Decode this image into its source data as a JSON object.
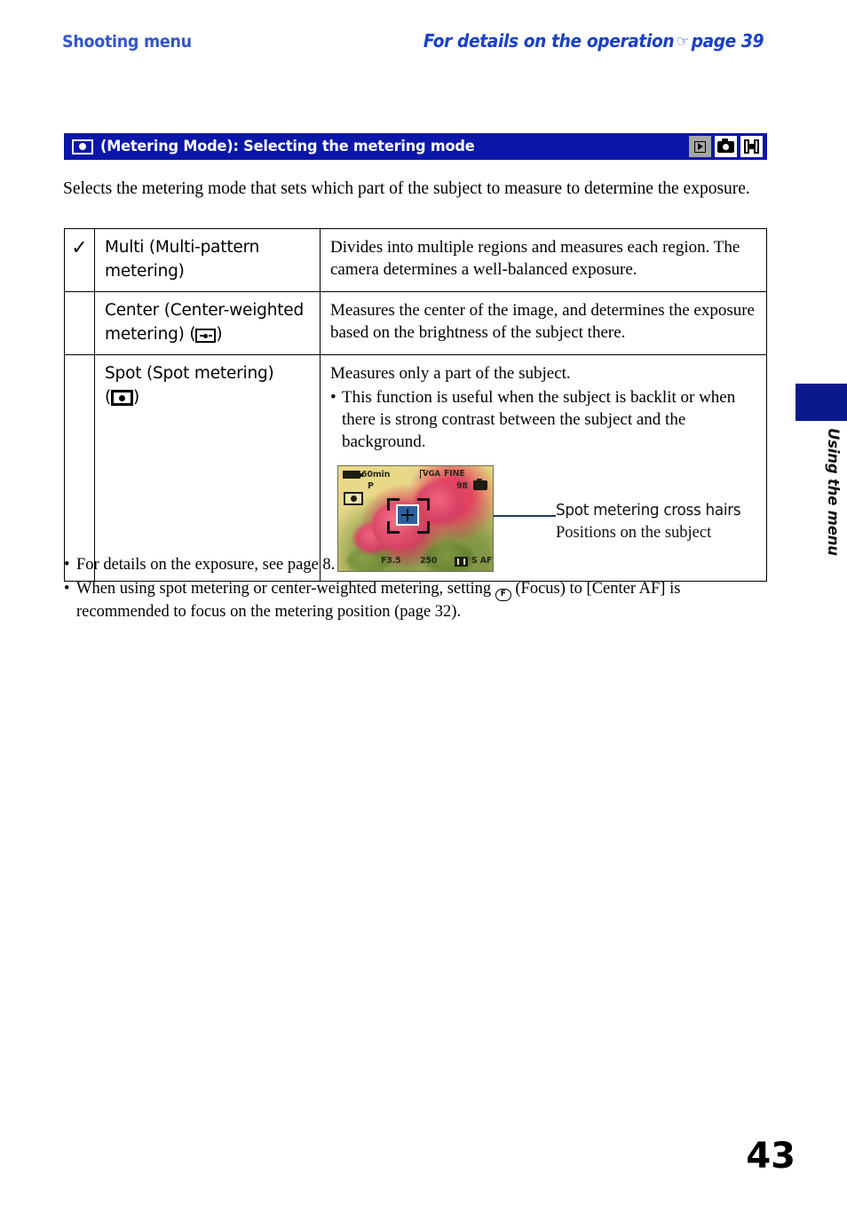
{
  "running_head": {
    "left": "Shooting menu",
    "right_before": "For details on the operation",
    "hand_icon": "☞",
    "right_after": "page 39"
  },
  "section_bar": {
    "icon_name": "metering-mode-icon",
    "title": "(Metering Mode): Selecting the metering mode",
    "mode_icons": [
      "playback-mode-icon",
      "still-camera-mode-icon",
      "movie-mode-icon"
    ],
    "background_color": "#0a17a8"
  },
  "intro": "Selects the metering mode that sets which part of the subject to measure to determine the exposure.",
  "table": {
    "rows": [
      {
        "default_marker": "✓",
        "name": "Multi (Multi-pattern metering)",
        "description": "Divides into multiple regions and measures each region. The camera determines a well-balanced exposure."
      },
      {
        "default_marker": "",
        "name_part1": "Center (Center-weighted",
        "name_part2": "metering) (",
        "name_part3": ")",
        "icon_name": "center-weighted-metering-icon",
        "description": "Measures the center of the image, and determines the exposure based on the brightness of the subject there."
      },
      {
        "default_marker": "",
        "name_part1": "Spot (Spot metering)",
        "name_part2": "(",
        "name_part3": ")",
        "icon_name": "spot-metering-icon",
        "description_lead": "Measures only a part of the subject.",
        "bullet": "This function is useful when the subject is backlit or when there is strong contrast between the subject and the background.",
        "bullet_mark": "•"
      }
    ]
  },
  "lcd_sample": {
    "battery_time": "60min",
    "rec_mode": "P",
    "metering_icon_name": "spot-metering-osd-icon",
    "image_size": "VGA",
    "image_quality": "FINE",
    "shots_remaining": "98",
    "media_icon_name": "internal-memory-icon",
    "aperture": "F3.5",
    "shutter_speed": "250",
    "af_icon_name": "center-af-frame-icon",
    "af_mode": "S AF",
    "crosshair_icon_name": "spot-metering-crosshair-icon"
  },
  "callout": {
    "title": "Spot metering cross hairs",
    "subtitle": "Positions on the subject",
    "line_color": "#1b3a63"
  },
  "notes": [
    {
      "mark": "•",
      "text": "For details on the exposure, see page 8."
    },
    {
      "mark": "•",
      "before": "When using spot metering or center-weighted metering, setting",
      "icon_name": "focus-icon",
      "icon_glyph": "F",
      "after": "(Focus) to [Center AF] is recommended to focus on the metering position (page 32)."
    }
  ],
  "side_tab": {
    "label": "Using the menu",
    "block_color": "#0a1a8c"
  },
  "folio": "43",
  "colors": {
    "heading_blue": "#3355cc",
    "accent_blue": "#1840c8",
    "bar_blue": "#0a17a8"
  }
}
